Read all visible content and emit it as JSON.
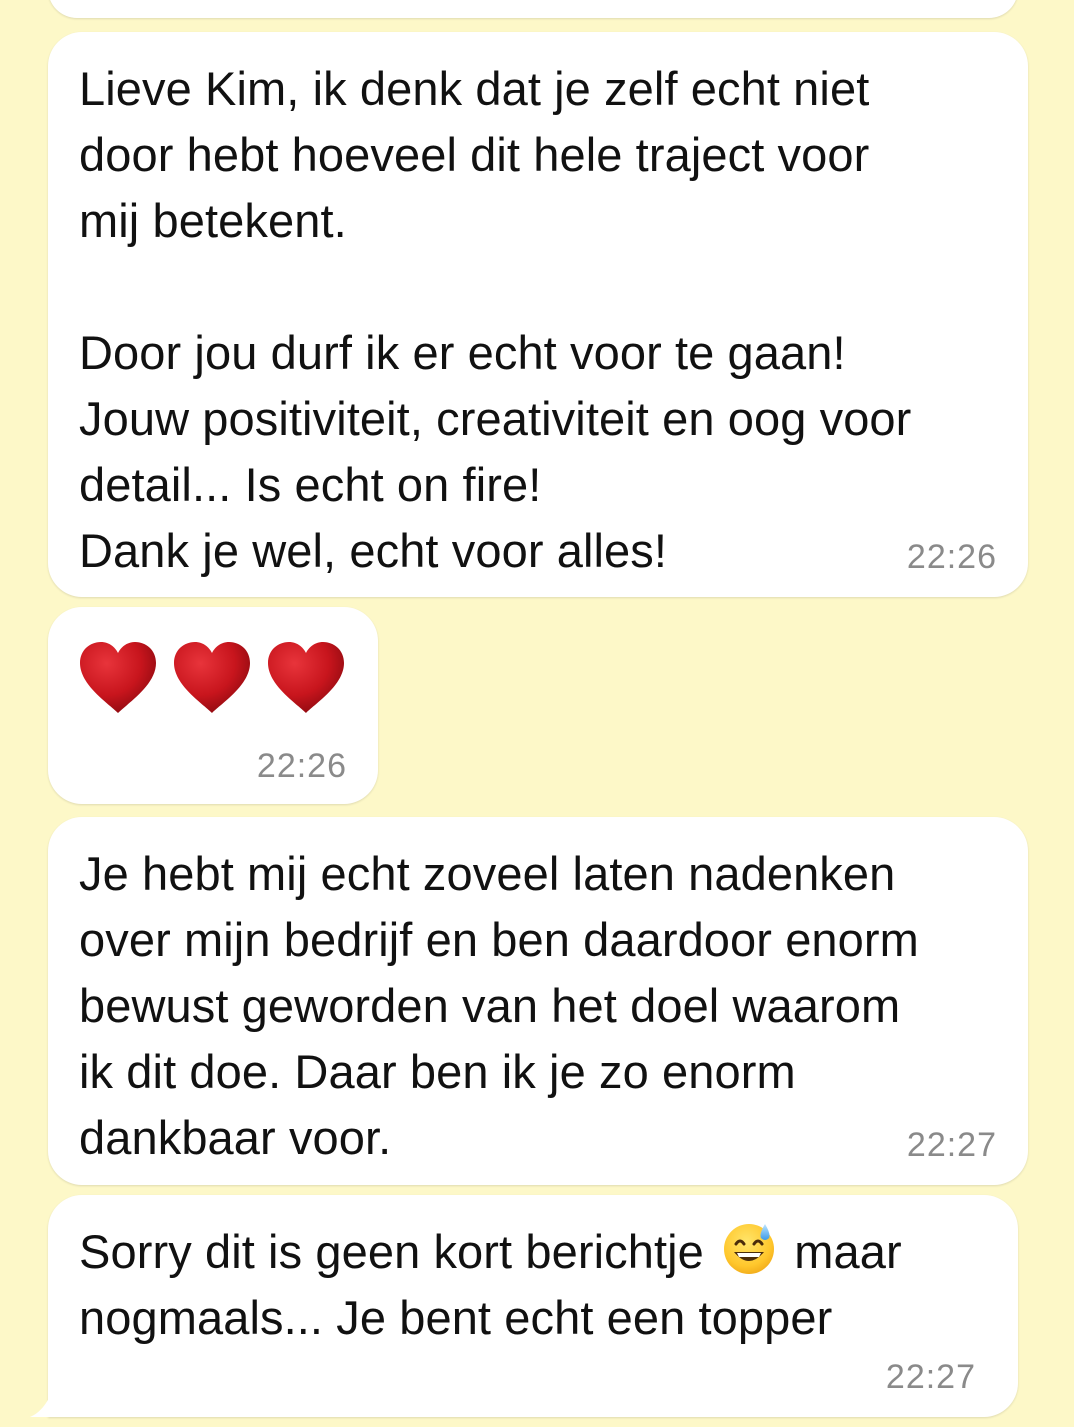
{
  "colors": {
    "chat_background": "#fdf8c8",
    "bubble_background": "#ffffff",
    "timestamp": "#8a8a8a",
    "heart": "#c8151d"
  },
  "messages": [
    {
      "lines": [
        "Lieve Kim, ik denk dat je zelf echt niet",
        "door hebt hoeveel dit hele traject voor",
        "mij betekent.",
        "",
        "Door jou durf ik er echt voor te gaan!",
        "Jouw positiviteit, creativiteit en oog voor",
        "detail... Is echt on fire!",
        "Dank je wel, echt voor alles!"
      ],
      "time": "22:26"
    },
    {
      "emoji": [
        "heart-icon",
        "heart-icon",
        "heart-icon"
      ],
      "time": "22:26"
    },
    {
      "lines": [
        "Je hebt mij echt zoveel laten nadenken",
        "over mijn bedrijf en ben daardoor enorm",
        "bewust geworden van het doel waarom",
        "ik dit doe. Daar ben ik je zo enorm",
        "dankbaar voor."
      ],
      "time": "22:27"
    },
    {
      "line1_before_emoji": "Sorry dit is geen kort berichtje ",
      "emoji": "grinning-face-with-sweat-icon",
      "line1_after_emoji": " maar",
      "line2": "nogmaals... Je bent echt een topper",
      "time": "22:27"
    }
  ]
}
